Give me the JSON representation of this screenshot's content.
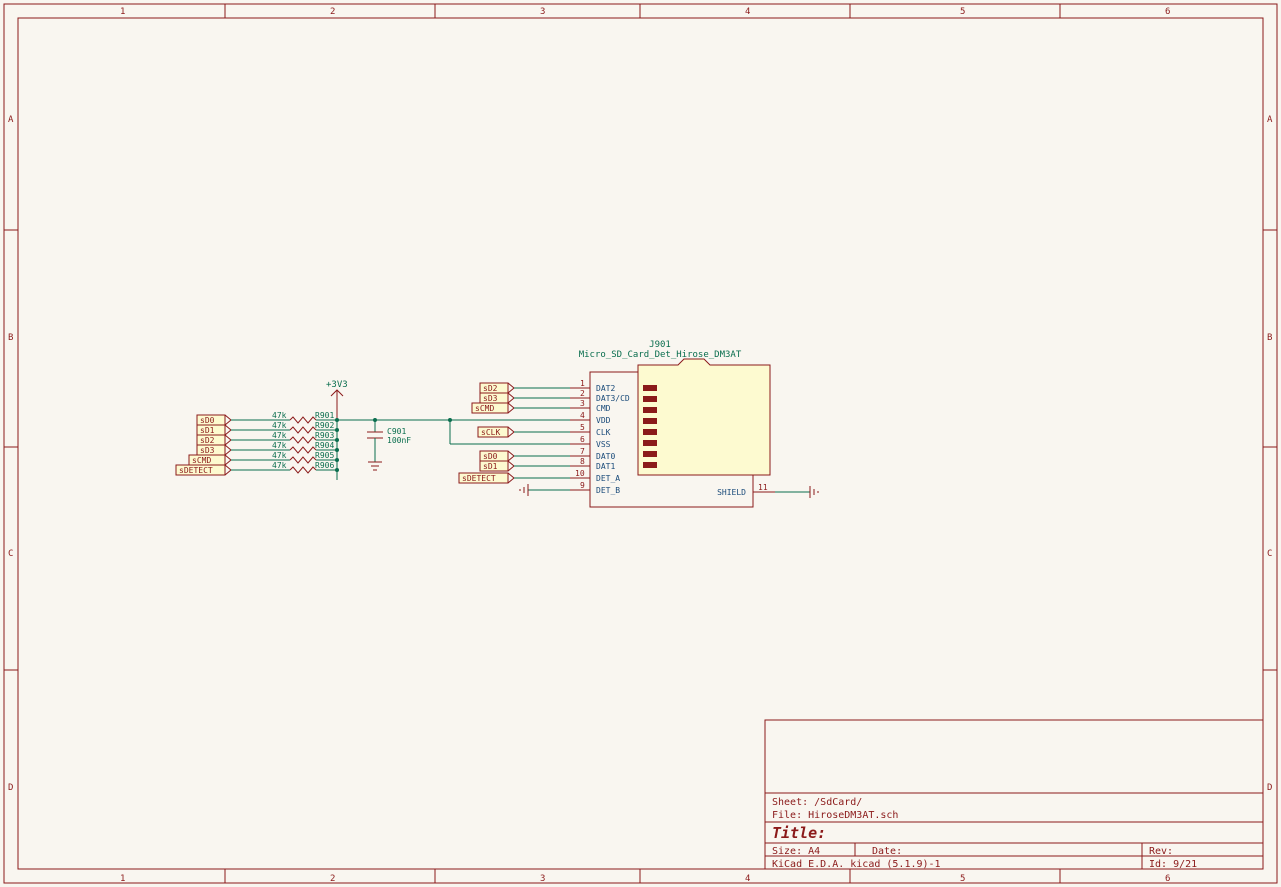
{
  "colors": {
    "frame": "#8B1A1A",
    "wire": "#0a6e4e",
    "label": "#1a4b7a",
    "compfill": "#fdfad0"
  },
  "frame": {
    "cols": [
      "1",
      "2",
      "3",
      "4",
      "5",
      "6"
    ],
    "rows": [
      "A",
      "B",
      "C",
      "D"
    ]
  },
  "power": {
    "label": "+3V3"
  },
  "resistors": {
    "value": "47k",
    "items": [
      {
        "ref": "R901",
        "net": "sD0"
      },
      {
        "ref": "R902",
        "net": "sD1"
      },
      {
        "ref": "R903",
        "net": "sD2"
      },
      {
        "ref": "R904",
        "net": "sD3"
      },
      {
        "ref": "R905",
        "net": "sCMD"
      },
      {
        "ref": "R906",
        "net": "sDETECT"
      }
    ]
  },
  "capacitor": {
    "ref": "C901",
    "value": "100nF"
  },
  "connector": {
    "ref": "J901",
    "desc": "Micro_SD_Card_Det_Hirose_DM3AT",
    "pins_left": [
      {
        "num": "1",
        "name": "DAT2",
        "net": "sD2"
      },
      {
        "num": "2",
        "name": "DAT3/CD",
        "net": "sD3"
      },
      {
        "num": "3",
        "name": "CMD",
        "net": "sCMD"
      },
      {
        "num": "4",
        "name": "VDD",
        "net": ""
      },
      {
        "num": "5",
        "name": "CLK",
        "net": "sCLK"
      },
      {
        "num": "6",
        "name": "VSS",
        "net": ""
      },
      {
        "num": "7",
        "name": "DAT0",
        "net": "sD0"
      },
      {
        "num": "8",
        "name": "DAT1",
        "net": "sD1"
      },
      {
        "num": "10",
        "name": "DET_A",
        "net": "sDETECT"
      },
      {
        "num": "9",
        "name": "DET_B",
        "net": ""
      }
    ],
    "pin_right": {
      "num": "11",
      "name": "SHIELD"
    }
  },
  "titleblock": {
    "sheet_label": "Sheet:",
    "sheet": "/SdCard/",
    "file_label": "File:",
    "file": "HiroseDM3AT.sch",
    "title_label": "Title:",
    "size_label": "Size:",
    "size": "A4",
    "date_label": "Date:",
    "tool": "KiCad E.D.A.  kicad (5.1.9)-1",
    "rev_label": "Rev:",
    "id_label": "Id:",
    "id": "9/21"
  }
}
